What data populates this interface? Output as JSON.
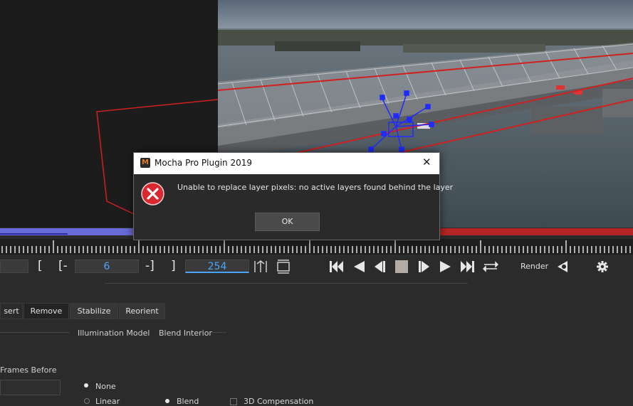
{
  "dialog": {
    "title": "Mocha Pro Plugin 2019",
    "message": "Unable to replace layer pixels: no active layers found behind the layer",
    "ok_label": "OK",
    "close_glyph": "✕",
    "error_icon": "error-icon",
    "app_icon_letter": "M"
  },
  "transport": {
    "in_point": "6",
    "out_point": "254",
    "bracket_open": "[",
    "bracket_in_open": "[-",
    "bracket_in_close": "-]",
    "bracket_close": "]",
    "render_label": "Render"
  },
  "tabs": {
    "insert": "sert",
    "remove": "Remove",
    "stabilize": "Stabilize",
    "reorient": "Reorient"
  },
  "sections": {
    "illumination_model": "Illumination Model",
    "blend_interior": "Blend Interior",
    "frames_before": "Frames Before"
  },
  "options": {
    "none": "None",
    "linear_partial": "Linear",
    "blend_partial": "Blend",
    "third_partial": "3D Compensation"
  },
  "colors": {
    "accent_blue": "#4aa3ff",
    "timeline_blue": "#6a6ad8",
    "timeline_red": "#b42626",
    "error_red": "#d9282f"
  }
}
